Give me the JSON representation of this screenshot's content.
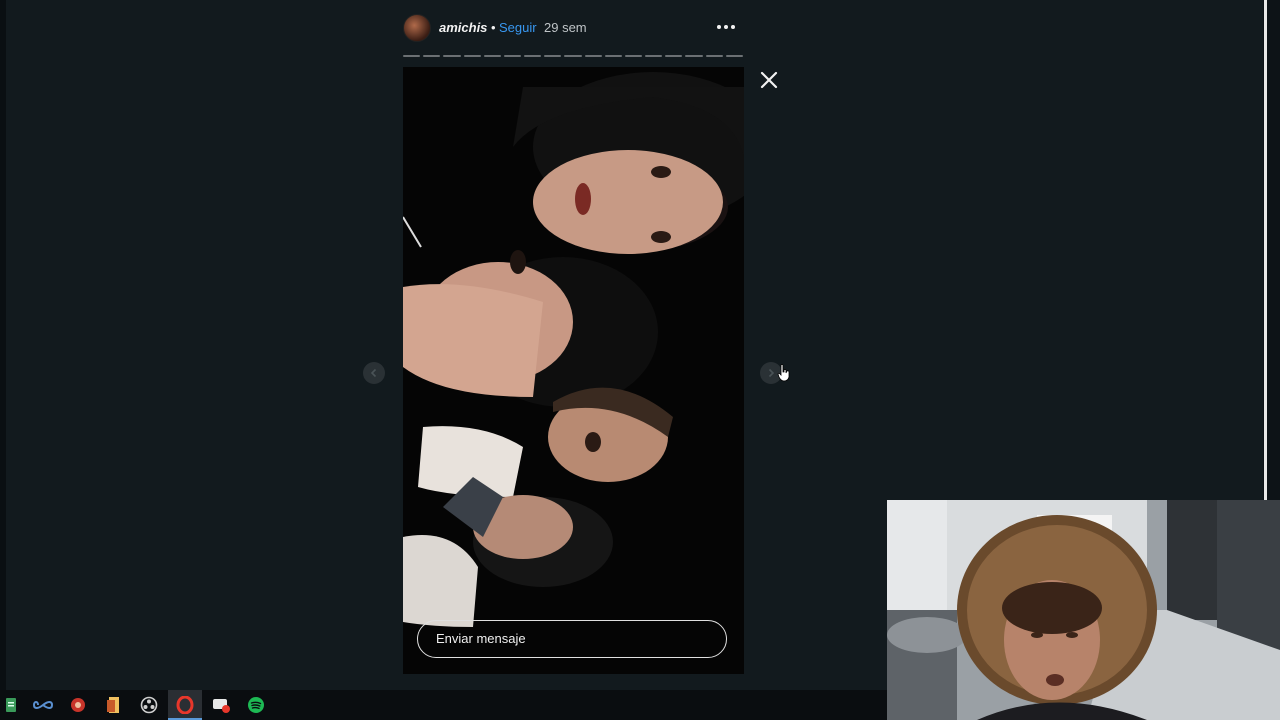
{
  "story": {
    "username": "amichis",
    "separator": "•",
    "follow_label": "Seguir",
    "posted_ago": "29 sem",
    "reply_placeholder": "Enviar mensaje",
    "progress_segments": 17
  },
  "icons": {
    "more": "more-options-icon",
    "close": "close-icon",
    "prev": "chevron-left-icon",
    "next": "chevron-right-icon"
  },
  "taskbar": {
    "apps": [
      {
        "name": "taskbar-app-file-icon"
      },
      {
        "name": "taskbar-app-infinity-icon"
      },
      {
        "name": "taskbar-app-red-icon"
      },
      {
        "name": "taskbar-app-document-icon"
      },
      {
        "name": "taskbar-app-obs-icon"
      },
      {
        "name": "taskbar-app-opera-icon",
        "active": true
      },
      {
        "name": "taskbar-app-chat-icon"
      },
      {
        "name": "taskbar-app-spotify-icon"
      }
    ]
  },
  "colors": {
    "background": "#121a1e",
    "link": "#3897f0",
    "opera": "#e8372b",
    "spotify": "#1db954"
  }
}
